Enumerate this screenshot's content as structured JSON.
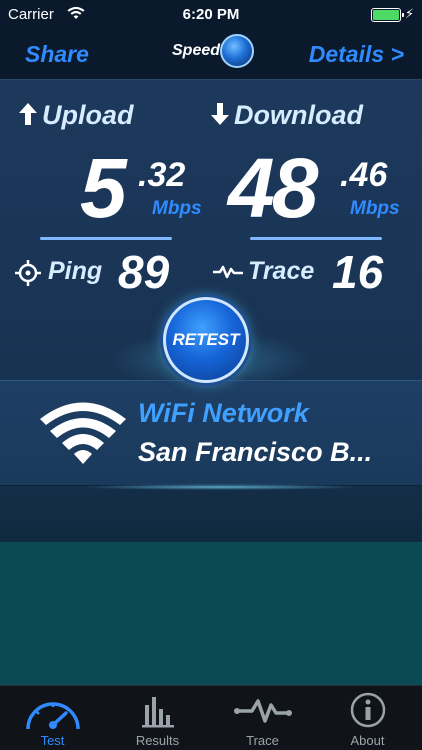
{
  "status_bar": {
    "carrier": "Carrier",
    "time": "6:20 PM"
  },
  "nav": {
    "share": "Share",
    "logo": "Speed",
    "details": "Details >"
  },
  "upload": {
    "label": "Upload",
    "integer": "5",
    "decimal": ".32",
    "unit": "Mbps"
  },
  "download": {
    "label": "Download",
    "integer": "48",
    "decimal": ".46",
    "unit": "Mbps"
  },
  "ping": {
    "label": "Ping",
    "value": "89"
  },
  "trace": {
    "label": "Trace",
    "value": "16"
  },
  "retest": {
    "label": "RETEST"
  },
  "network": {
    "type": "WiFi Network",
    "name": "San Francisco B..."
  },
  "tabs": [
    {
      "label": "Test",
      "icon": "speedometer-icon",
      "active": true
    },
    {
      "label": "Results",
      "icon": "bar-chart-icon",
      "active": false
    },
    {
      "label": "Trace",
      "icon": "trace-wave-icon",
      "active": false
    },
    {
      "label": "About",
      "icon": "info-icon",
      "active": false
    }
  ],
  "colors": {
    "accent": "#2f8bff",
    "battery": "#4cd964",
    "label": "#d7ecff"
  }
}
